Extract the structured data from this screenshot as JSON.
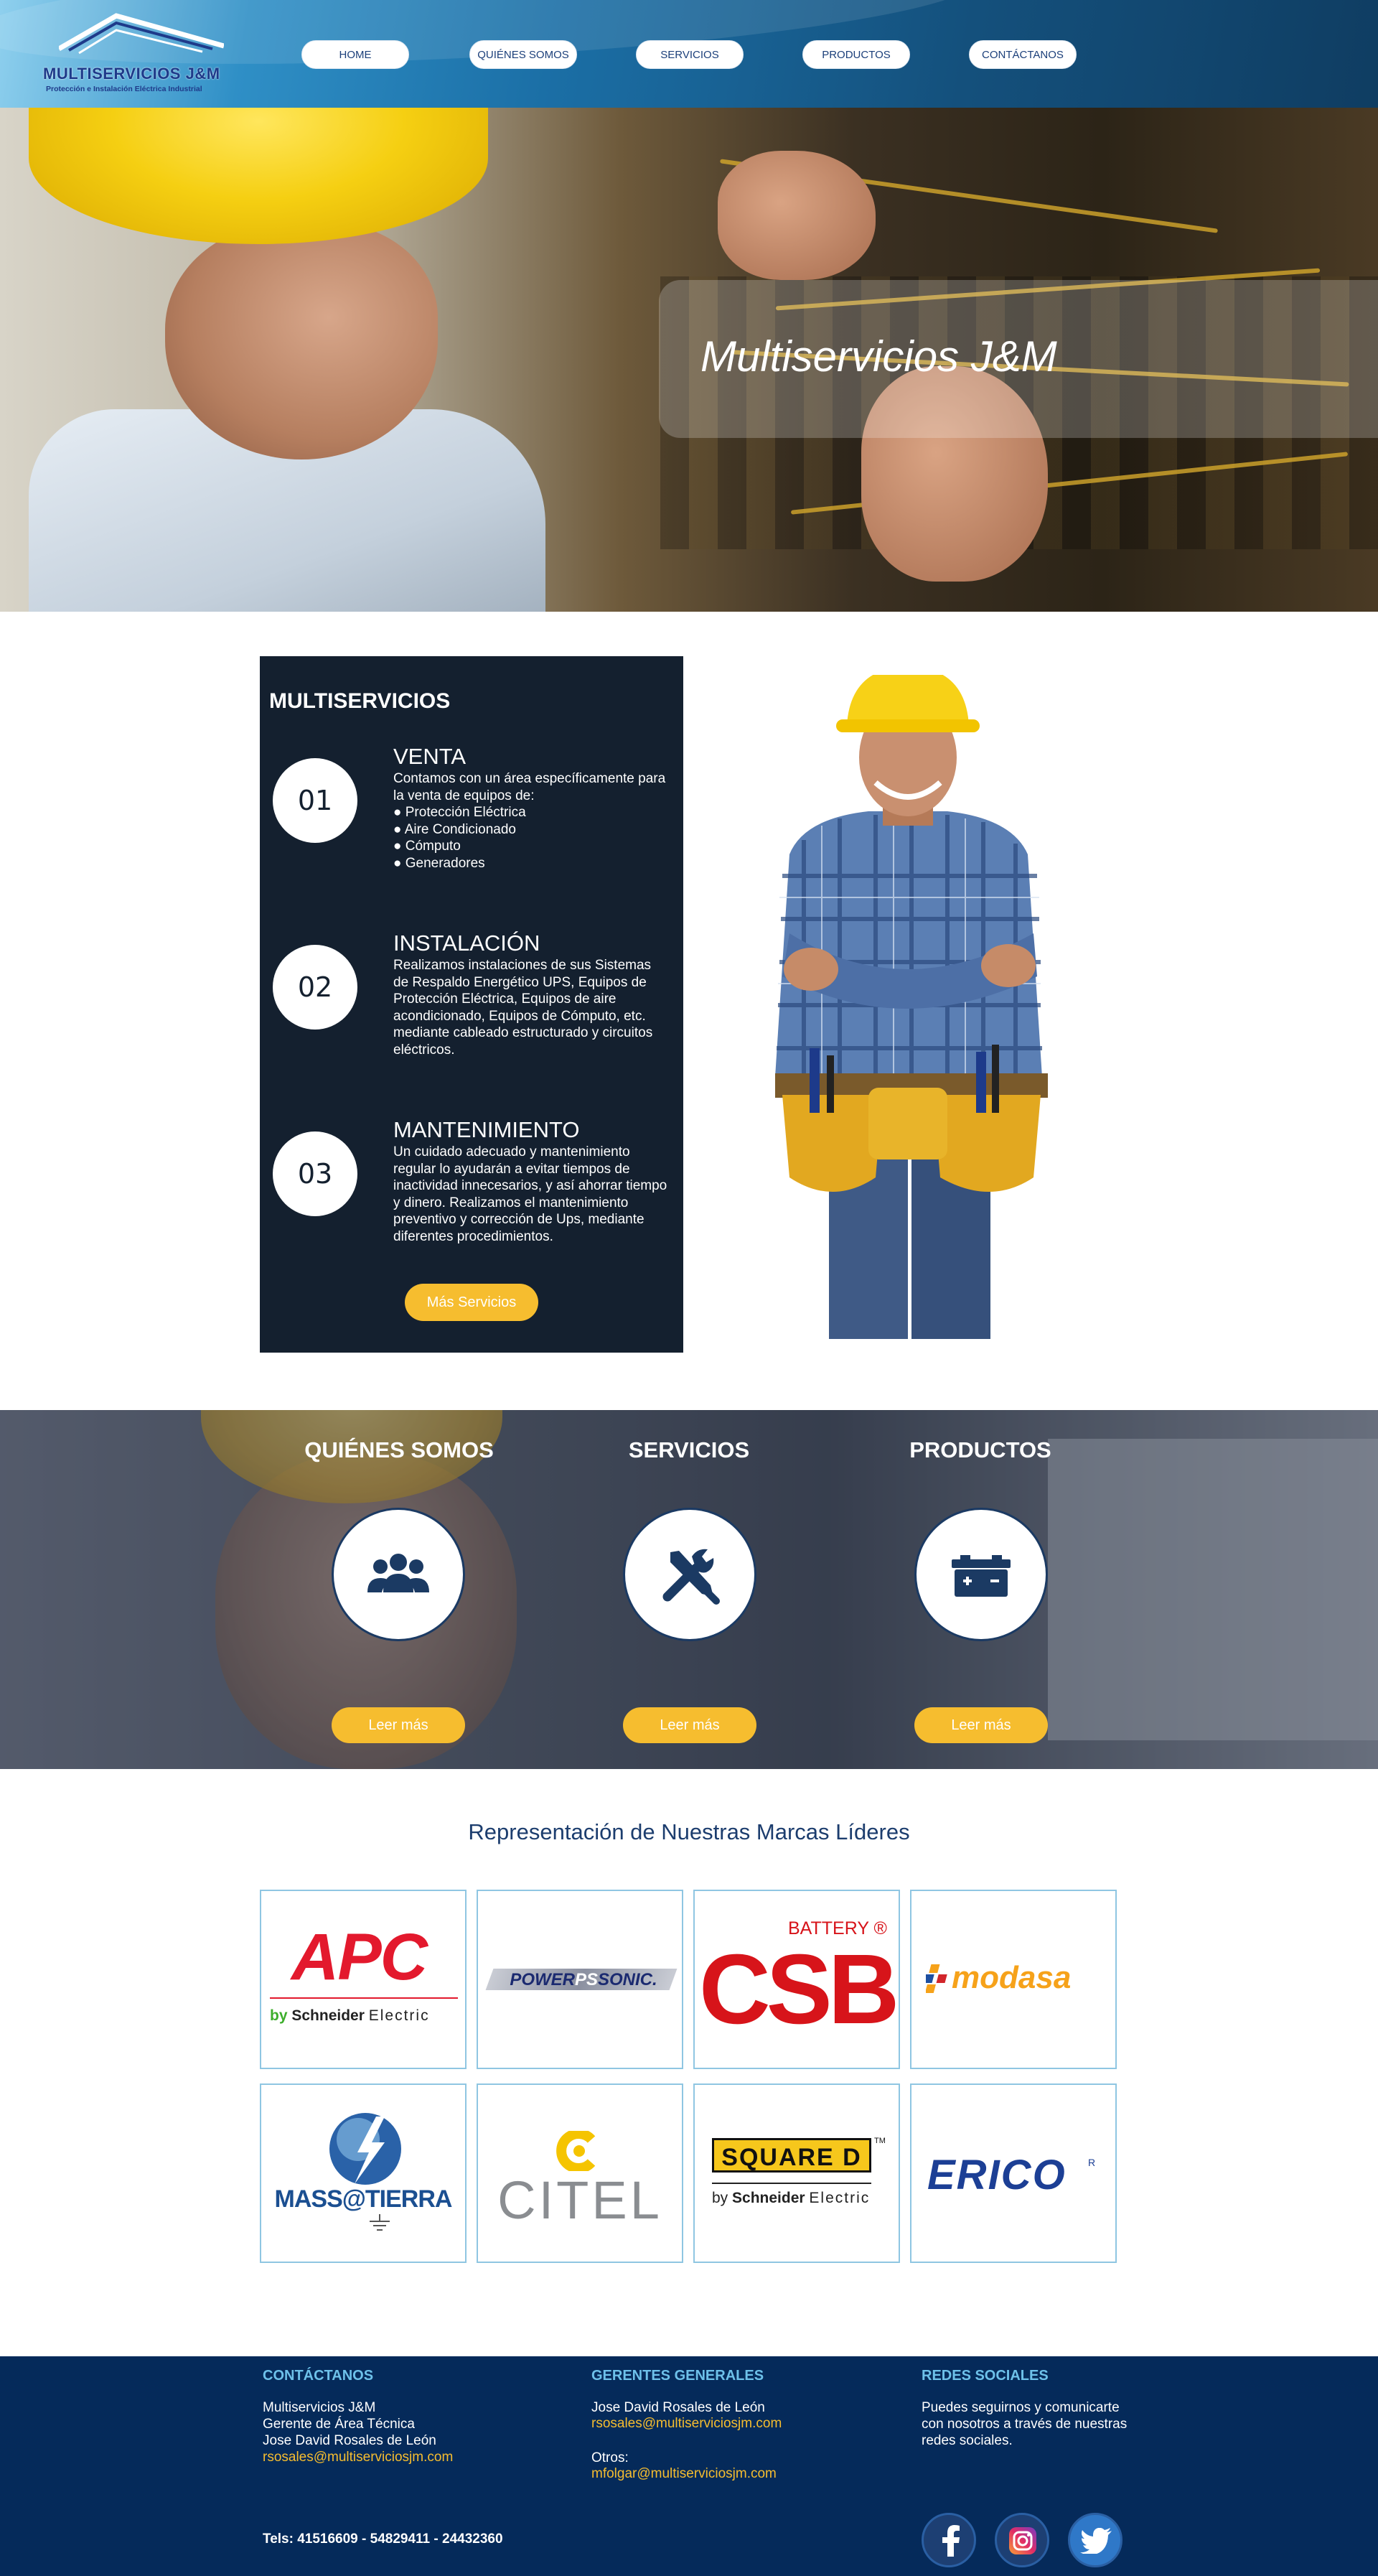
{
  "brand": {
    "name": "MULTISERVICIOS J&M",
    "tagline": "Protección e Instalación Eléctrica Industrial"
  },
  "nav": {
    "items": [
      "HOME",
      "QUIÉNES SOMOS",
      "SERVICIOS",
      "PRODUCTOS",
      "CONTÁCTANOS"
    ]
  },
  "hero": {
    "title": "Multiservicios J&M"
  },
  "services_intro": {
    "heading": "MULTISERVICIOS",
    "items": [
      {
        "number": "01",
        "title": "VENTA",
        "lines": [
          "Contamos con un área específicamente para",
          "la venta de equipos de:",
          "● Protección Eléctrica",
          "● Aire Condicionado",
          "● Cómputo",
          "● Generadores"
        ]
      },
      {
        "number": "02",
        "title": "INSTALACIÓN",
        "lines": [
          "Realizamos instalaciones de sus Sistemas",
          "de Respaldo Energético UPS, Equipos de",
          "Protección Eléctrica, Equipos de aire",
          "acondicionado, Equipos de Cómputo, etc.",
          "mediante cableado estructurado y circuitos",
          "eléctricos."
        ]
      },
      {
        "number": "03",
        "title": "MANTENIMIENTO",
        "lines": [
          "Un cuidado adecuado y mantenimiento",
          "regular lo ayudarán a evitar tiempos de",
          "inactividad innecesarios, y así ahorrar tiempo",
          "y dinero. Realizamos el mantenimiento",
          "preventivo y corrección de Ups, mediante",
          "diferentes procedimientos."
        ]
      }
    ],
    "button": "Más Servicios"
  },
  "categories": [
    {
      "title": "QUIÉNES SOMOS",
      "icon": "users-icon",
      "button": "Leer más"
    },
    {
      "title": "SERVICIOS",
      "icon": "tools-icon",
      "button": "Leer más"
    },
    {
      "title": "PRODUCTOS",
      "icon": "battery-icon",
      "button": "Leer más"
    }
  ],
  "brands": {
    "title": "Representación de Nuestras Marcas Líderes",
    "apc": {
      "name": "APC",
      "sub_by": "by",
      "sub_brand": "Schneider",
      "sub_tail": "Electric"
    },
    "powersonic": {
      "name_a": "POWER",
      "name_b": "PS",
      "name_c": "SONIC."
    },
    "csb": {
      "name": "CSB",
      "battery": "BATTERY",
      "reg": "®"
    },
    "modasa": {
      "name": "modasa"
    },
    "masstierra": {
      "name": "MASS@TIERRA"
    },
    "citel": {
      "name": "CITEL"
    },
    "squared": {
      "name": "SQUARE D",
      "tm": "TM",
      "sub_by": "by",
      "sub_brand": "Schneider",
      "sub_tail": "Electric"
    },
    "erico": {
      "name": "ERICO",
      "reg": "R"
    }
  },
  "footer": {
    "contact": {
      "heading": "CONTÁCTANOS",
      "lines": [
        "Multiservicios J&M",
        "Gerente de Área Técnica",
        "Jose David Rosales de León"
      ],
      "email": "rsosales@multiserviciosjm.com",
      "phones": "Tels: 41516609 - 54829411 - 24432360"
    },
    "managers": {
      "heading": "GERENTES GENERALES",
      "name": "Jose David Rosales de León",
      "email": "rsosales@multiserviciosjm.com",
      "others_label": "Otros:",
      "others_email": "mfolgar@multiserviciosjm.com"
    },
    "social": {
      "heading": "REDES SOCIALES",
      "lines": [
        "Puedes seguirnos y comunicarte",
        "con nosotros a través de nuestras",
        "redes sociales."
      ],
      "networks": [
        "facebook-icon",
        "instagram-icon",
        "twitter-icon"
      ]
    }
  },
  "colors": {
    "accent": "#f6bd2f",
    "panel": "#14202f",
    "footer": "#052a5a",
    "footer_heading": "#6ec1ea",
    "brand_blue": "#1c3d6e"
  }
}
